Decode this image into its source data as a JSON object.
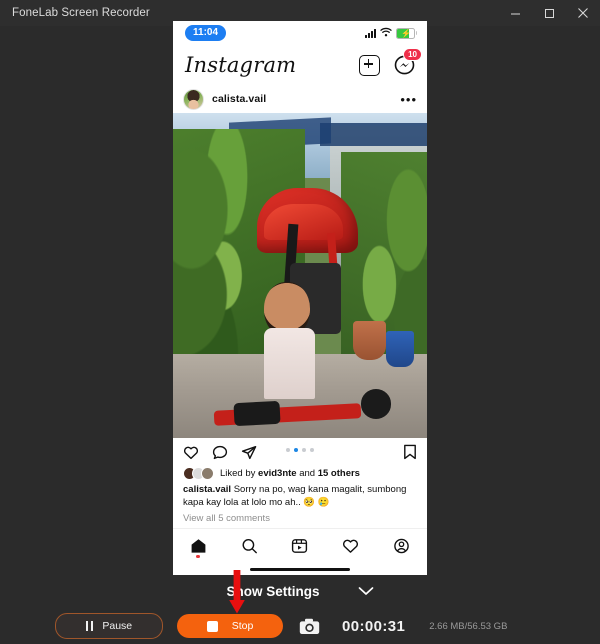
{
  "window": {
    "title": "FoneLab Screen Recorder",
    "controls": {
      "minimize": "minimize-icon",
      "maximize": "maximize-icon",
      "close": "close-icon"
    }
  },
  "capture": {
    "status_bar": {
      "time": "11:04",
      "icons": [
        "signal-icon",
        "wifi-icon",
        "battery-charging-icon"
      ]
    },
    "instagram": {
      "logo": "Instagram",
      "header_icons": [
        "plus-square-icon",
        "messenger-icon"
      ],
      "messenger_badge": "10",
      "post": {
        "username": "calista.vail",
        "more_label": "•••",
        "carousel_dots": 4,
        "carousel_active": 2,
        "likes_text_prefix": "Liked by ",
        "likes_user": "evid3nte",
        "likes_text_suffix": " and ",
        "likes_others": "15 others",
        "caption_user": "calista.vail",
        "caption_text": " Sorry na po, wag kana magalit, sumbong kapa kay lola at lolo mo ah.. 🥺 🥲",
        "view_comments": "View all 5 comments",
        "action_icons": [
          "heart-icon",
          "comment-icon",
          "share-icon",
          "bookmark-icon"
        ]
      },
      "bottom_nav": [
        "home-icon",
        "search-icon",
        "reels-icon",
        "activity-icon",
        "profile-icon"
      ]
    }
  },
  "settings_bar": {
    "label": "Show Settings",
    "chevron": "chevron-down-icon",
    "arrow": "red-down-arrow-annotation"
  },
  "controls": {
    "pause_label": "Pause",
    "stop_label": "Stop",
    "screenshot_icon": "camera-icon",
    "timer": "00:00:31",
    "usage": "2.66 MB/56.53 GB"
  },
  "colors": {
    "window_bg": "#2b2b2b",
    "titlebar_bg": "#2e2e2e",
    "accent_orange": "#f4620e",
    "pause_border": "#a0562a",
    "annotation_red": "#e80f0f",
    "ig_blue": "#1d7ef2",
    "badge_red": "#ef2f4a"
  }
}
